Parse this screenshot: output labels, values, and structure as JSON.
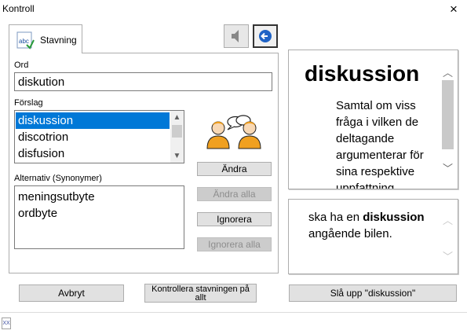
{
  "window": {
    "title": "Kontroll",
    "close_glyph": "×"
  },
  "tabs": [
    {
      "label": "Stavning",
      "icon": "abc-spelling-icon"
    }
  ],
  "toolbar": {
    "speaker_icon": "speaker-icon",
    "back_icon": "back-arrow-icon"
  },
  "word_field": {
    "label": "Ord",
    "value": "diskution"
  },
  "suggestions": {
    "label": "Förslag",
    "items": [
      "diskussion",
      "discotrion",
      "disfusion"
    ],
    "selected_index": 0
  },
  "synonyms": {
    "label": "Alternativ (Synonymer)",
    "items": [
      "meningsutbyte",
      "ordbyte"
    ]
  },
  "action_buttons": {
    "change": "Ändra",
    "change_all": "Ändra alla",
    "ignore": "Ignorera",
    "ignore_all": "Ignorera alla"
  },
  "definition": {
    "word": "diskussion",
    "lines": [
      "Samtal om viss",
      "fråga i vilken de",
      "deltagande",
      "argumenterar för",
      "sina respektive",
      "uppfattning"
    ]
  },
  "example": {
    "before": "ska ha en ",
    "highlight": "diskussion",
    "after": " angående bilen."
  },
  "footer_buttons": {
    "cancel": "Avbryt",
    "check_all_line1": "Kontrollera stavningen på",
    "check_all_line2": "allt",
    "lookup": "Slå upp \"diskussion\""
  },
  "status": {
    "icon": "document-icon",
    "icon_text": "XX"
  },
  "colors": {
    "selection": "#0078d7",
    "button_face": "#e1e1e1",
    "disabled_text": "#8d8d8d",
    "hair_color": "#f0a020"
  }
}
